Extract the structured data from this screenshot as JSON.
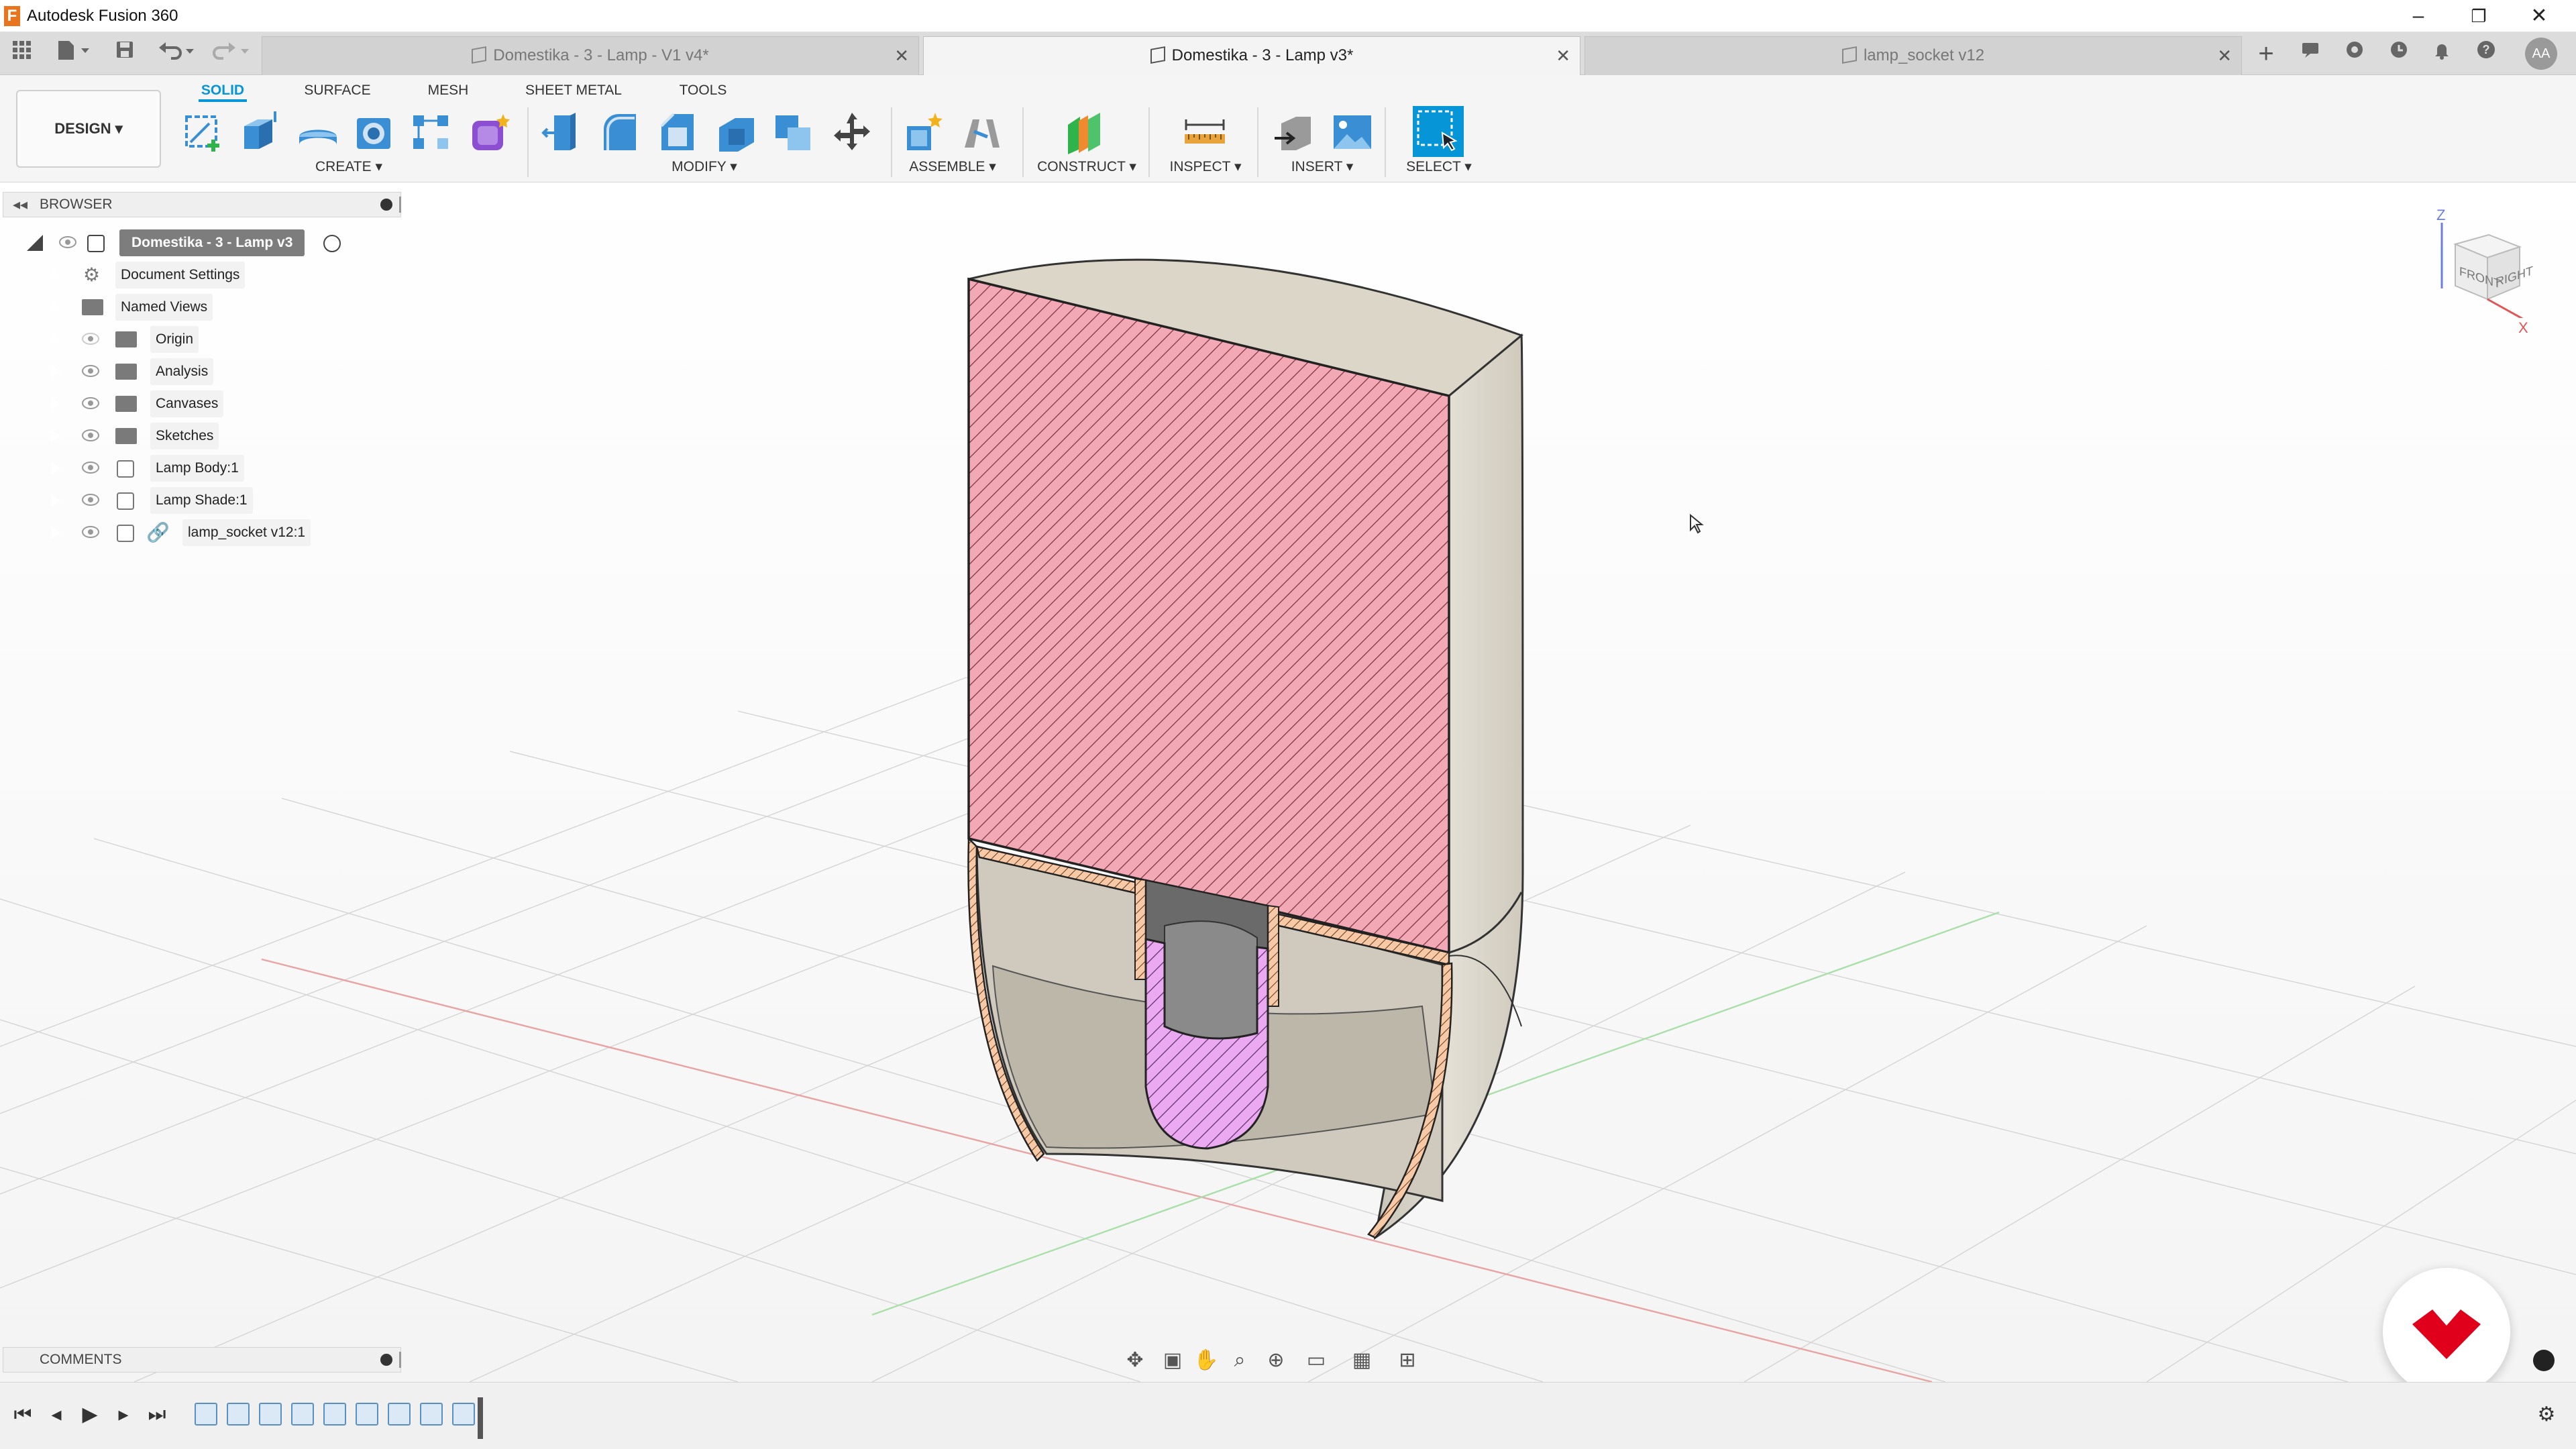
{
  "window": {
    "title": "Autodesk Fusion 360",
    "app_logo_letter": "F",
    "controls": {
      "minimize": "–",
      "restore": "❐",
      "close": "✕"
    }
  },
  "tabs": [
    {
      "label": "Domestika - 3 - Lamp - V1 v4*",
      "active": false
    },
    {
      "label": "Domestika - 3 - Lamp v3*",
      "active": true
    },
    {
      "label": "lamp_socket v12",
      "active": false
    }
  ],
  "tab_close": "✕",
  "tab_add": "+",
  "user_initials": "AA",
  "ribbon": {
    "workspace": "DESIGN ▾",
    "tabs": [
      "SOLID",
      "SURFACE",
      "MESH",
      "SHEET METAL",
      "TOOLS"
    ],
    "active_tab": "SOLID",
    "groups": {
      "create": "CREATE ▾",
      "modify": "MODIFY ▾",
      "assemble": "ASSEMBLE ▾",
      "construct": "CONSTRUCT ▾",
      "inspect": "INSPECT ▾",
      "insert": "INSERT ▾",
      "select": "SELECT ▾"
    }
  },
  "browser": {
    "title": "BROWSER",
    "root": "Domestika - 3 - Lamp v3",
    "items": [
      {
        "label": "Document Settings"
      },
      {
        "label": "Named Views"
      },
      {
        "label": "Origin"
      },
      {
        "label": "Analysis"
      },
      {
        "label": "Canvases"
      },
      {
        "label": "Sketches"
      },
      {
        "label": "Lamp Body:1"
      },
      {
        "label": "Lamp Shade:1"
      },
      {
        "label": "lamp_socket v12:1"
      }
    ]
  },
  "viewcube": {
    "front": "FRONT",
    "right": "RIGHT",
    "axis_z": "Z",
    "axis_x": "X"
  },
  "comments": {
    "title": "COMMENTS"
  },
  "colors": {
    "accent": "#0696d7",
    "section_red": "#f2a7b4",
    "section_purple": "#e9a8ef",
    "body": "#d8d3c7",
    "brand": "#e0001b"
  }
}
